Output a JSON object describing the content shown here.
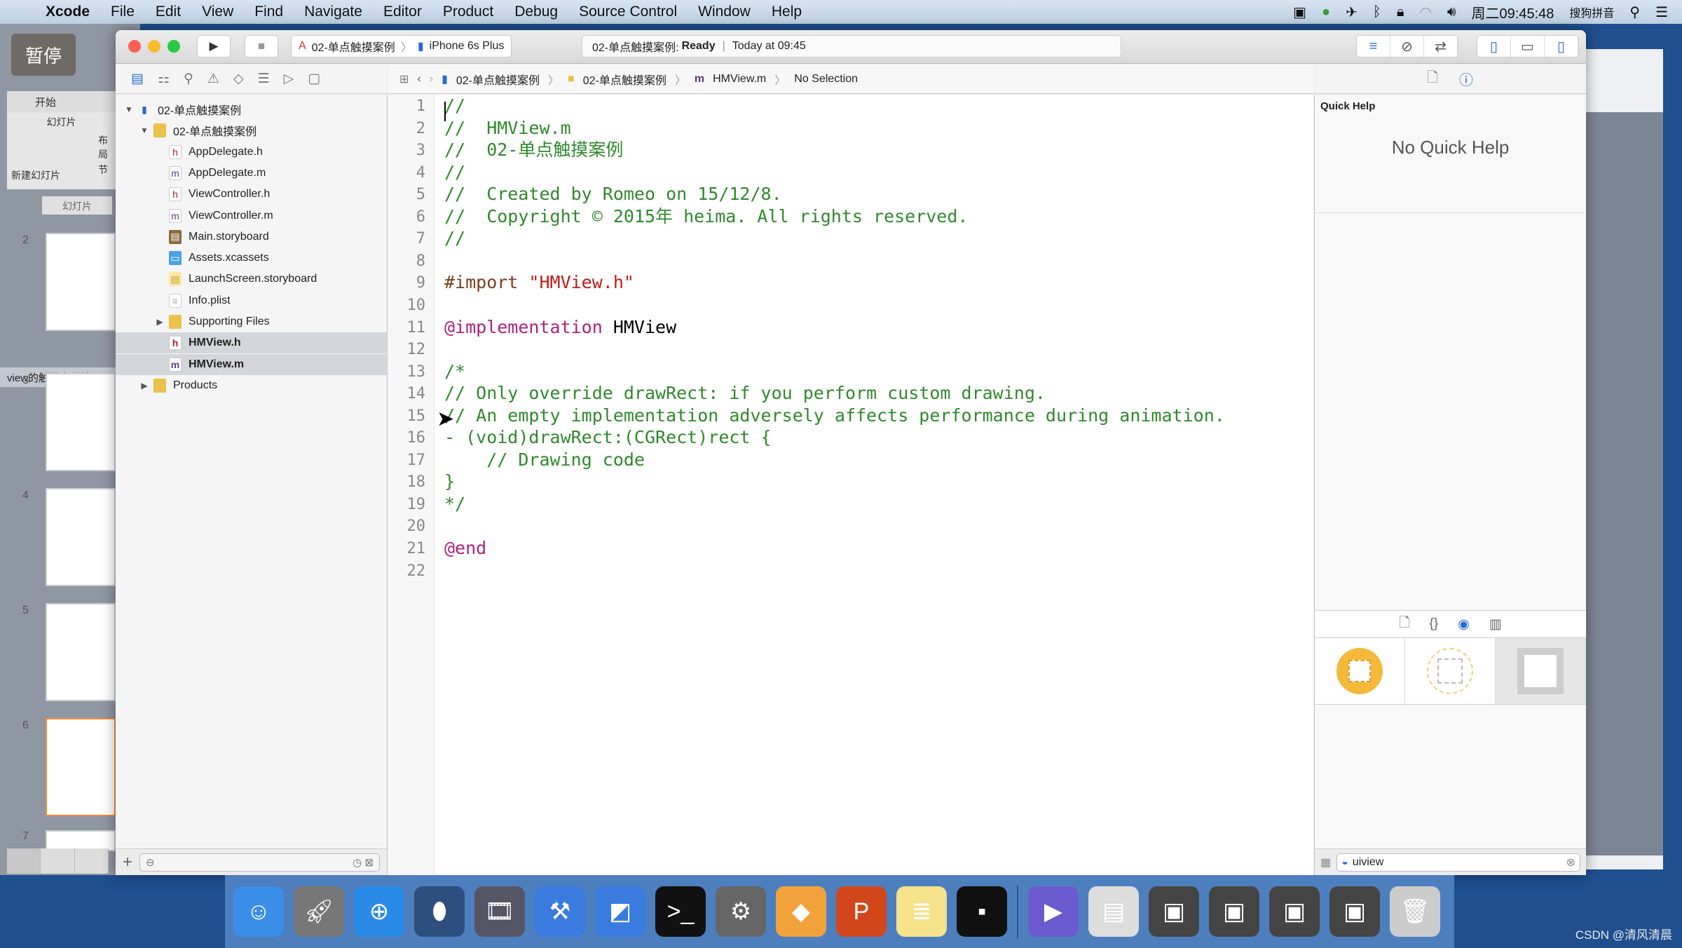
{
  "menubar": {
    "items": [
      "Xcode",
      "File",
      "Edit",
      "View",
      "Find",
      "Navigate",
      "Editor",
      "Product",
      "Debug",
      "Source Control",
      "Window",
      "Help"
    ],
    "clock": "周二09:45:48",
    "input_method": "搜狗拼音"
  },
  "overlay": {
    "pause_label": "暂停"
  },
  "ppt": {
    "tabs": [
      "开始",
      "幻灯片"
    ],
    "new_slide": "新建幻灯片",
    "layout": "布局",
    "section": "节",
    "section_header": "view的触摸事件处",
    "slide_numbers": [
      "2",
      "3",
      "4",
      "5",
      "6",
      "7"
    ]
  },
  "toolbar": {
    "scheme": "02-单点触摸案例",
    "device": "iPhone 6s Plus",
    "activity_project": "02-单点触摸案例:",
    "activity_status": "Ready",
    "activity_time": "Today at 09:45"
  },
  "jumpbar": {
    "project": "02-单点触摸案例",
    "group": "02-单点触摸案例",
    "file": "HMView.m",
    "selection": "No Selection"
  },
  "navigator": {
    "rows": [
      {
        "label": "02-单点触摸案例",
        "level": 0,
        "icon": "project",
        "disclosure": "open"
      },
      {
        "label": "02-单点触摸案例",
        "level": 1,
        "icon": "folder",
        "disclosure": "open"
      },
      {
        "label": "AppDelegate.h",
        "level": 2,
        "icon": "h"
      },
      {
        "label": "AppDelegate.m",
        "level": 2,
        "icon": "m"
      },
      {
        "label": "ViewController.h",
        "level": 2,
        "icon": "h"
      },
      {
        "label": "ViewController.m",
        "level": 2,
        "icon": "m"
      },
      {
        "label": "Main.storyboard",
        "level": 2,
        "icon": "storyboard"
      },
      {
        "label": "Assets.xcassets",
        "level": 2,
        "icon": "assets"
      },
      {
        "label": "LaunchScreen.storyboard",
        "level": 2,
        "icon": "launch"
      },
      {
        "label": "Info.plist",
        "level": 2,
        "icon": "plist"
      },
      {
        "label": "Supporting Files",
        "level": 2,
        "icon": "folder",
        "disclosure": "closed"
      },
      {
        "label": "HMView.h",
        "level": 2,
        "icon": "h",
        "selected": true
      },
      {
        "label": "HMView.m",
        "level": 2,
        "icon": "m",
        "selected": true
      },
      {
        "label": "Products",
        "level": 1,
        "icon": "folder",
        "disclosure": "closed"
      }
    ]
  },
  "editor": {
    "colors": {
      "comment": "#2e8a2a",
      "string": "#c41a16",
      "preproc": "#7a3e1f",
      "keyword": "#b0207f",
      "plain": "#000000"
    },
    "lines": [
      [
        {
          "t": "//",
          "k": "comment"
        }
      ],
      [
        {
          "t": "//  HMView.m",
          "k": "comment"
        }
      ],
      [
        {
          "t": "//  02-单点触摸案例",
          "k": "comment"
        }
      ],
      [
        {
          "t": "//",
          "k": "comment"
        }
      ],
      [
        {
          "t": "//  Created by Romeo on 15/12/8.",
          "k": "comment"
        }
      ],
      [
        {
          "t": "//  Copyright © 2015年 heima. All rights reserved.",
          "k": "comment"
        }
      ],
      [
        {
          "t": "//",
          "k": "comment"
        }
      ],
      [],
      [
        {
          "t": "#import ",
          "k": "preproc"
        },
        {
          "t": "\"HMView.h\"",
          "k": "string"
        }
      ],
      [],
      [
        {
          "t": "@implementation",
          "k": "keyword"
        },
        {
          "t": " HMView",
          "k": "plain"
        }
      ],
      [],
      [
        {
          "t": "/*",
          "k": "comment"
        }
      ],
      [
        {
          "t": "// Only override drawRect: if you perform custom drawing.",
          "k": "comment"
        }
      ],
      [
        {
          "t": "// An empty implementation adversely affects performance during animation.",
          "k": "comment"
        }
      ],
      [
        {
          "t": "- (void)drawRect:(CGRect)rect {",
          "k": "comment"
        }
      ],
      [
        {
          "t": "    // Drawing code",
          "k": "comment"
        }
      ],
      [
        {
          "t": "}",
          "k": "comment"
        }
      ],
      [
        {
          "t": "*/",
          "k": "comment"
        }
      ],
      [],
      [
        {
          "t": "@end",
          "k": "keyword"
        }
      ],
      []
    ],
    "line_numbers": [
      "1",
      "2",
      "3",
      "4",
      "5",
      "6",
      "7",
      "8",
      "9",
      "10",
      "11",
      "12",
      "13",
      "14",
      "15",
      "16",
      "17",
      "18",
      "19",
      "20",
      "21",
      "22"
    ]
  },
  "inspector": {
    "quick_help_title": "Quick Help",
    "quick_help_empty": "No Quick Help",
    "library_search_value": "uiview"
  },
  "dock": {
    "apps": [
      "finder",
      "launchpad",
      "safari",
      "mouse",
      "imovie",
      "xcode",
      "instruments",
      "terminal",
      "system-preferences",
      "sketch",
      "powerpoint",
      "notes",
      "console",
      "media-player",
      "preview",
      "screenshot-1",
      "screenshot-2",
      "screenshot-3",
      "screenshot-4",
      "trash"
    ]
  },
  "watermark": "CSDN @清风清晨"
}
